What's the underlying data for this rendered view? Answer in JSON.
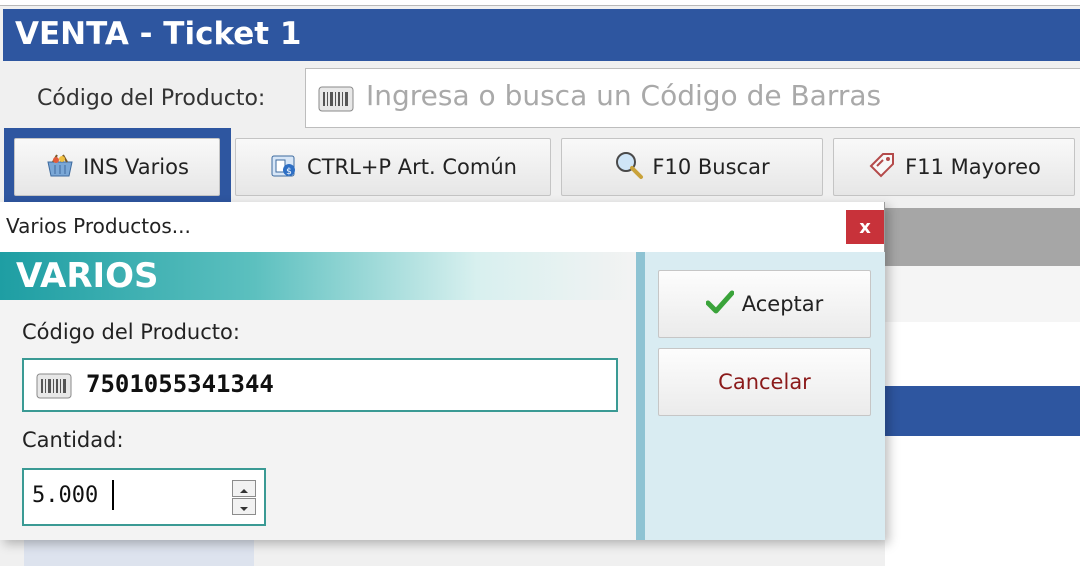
{
  "window": {
    "title": "VENTA - Ticket 1"
  },
  "search": {
    "label": "Código del Producto:",
    "placeholder": "Ingresa o busca un Código de Barras"
  },
  "toolbar": {
    "buttons": [
      {
        "label": "INS Varios",
        "icon": "basket-icon"
      },
      {
        "label": "CTRL+P Art. Común",
        "icon": "product-box-icon"
      },
      {
        "label": "F10 Buscar",
        "icon": "magnifier-icon"
      },
      {
        "label": "F11 Mayoreo",
        "icon": "price-tag-icon"
      }
    ]
  },
  "dialog": {
    "title": "Varios Productos...",
    "close_label": "x",
    "banner": "VARIOS",
    "code_label": "Código del Producto:",
    "code_value": "7501055341344",
    "quantity_label": "Cantidad:",
    "quantity_value": "5.000",
    "accept_label": "Aceptar",
    "cancel_label": "Cancelar"
  },
  "colors": {
    "title_bar": "#2e56a0",
    "banner_teal": "#1e9ea3",
    "close_red": "#c8323a",
    "field_border": "#3a9a94",
    "right_panel": "#d9ecf2",
    "cancel_text": "#8b1a1a",
    "check_green": "#3aa33a"
  }
}
